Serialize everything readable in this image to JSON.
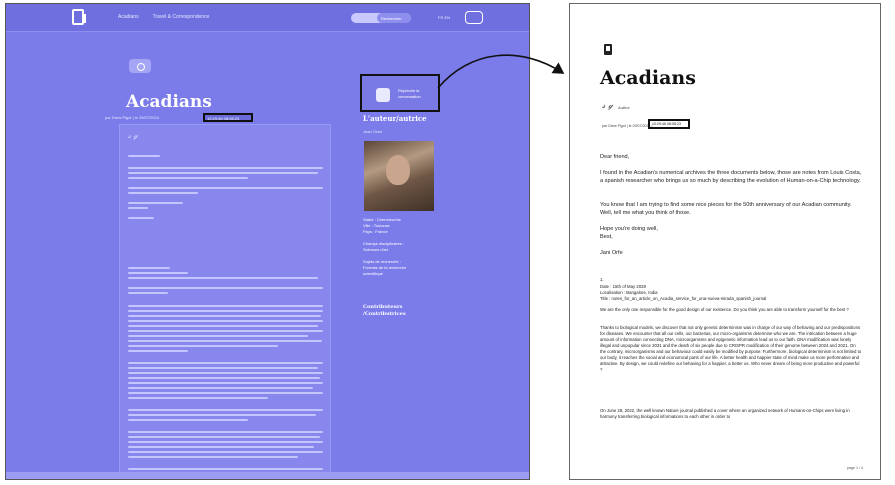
{
  "app": {
    "nav": [
      "Acadians",
      "Travel & Correspondence"
    ],
    "search_label": "Rechercher",
    "lang": "FR EN",
    "title": "Acadians",
    "meta": "par Drew Pigot | le 29/07/2024",
    "date_highlight": "10:29:46 08:08:23",
    "side_box_text_1": "Rejoindre la",
    "side_box_text_2": "conversation",
    "side_heading": "L'auteur/autrice",
    "side_sub": "Jean Ochs",
    "side_info_1": "Statut : Chercheur/se",
    "side_info_2": "Ville : Toulouse",
    "side_info_3": "Pays : France",
    "side_info_4": "Champs disciplinaires :",
    "side_info_5": "Sciences d'art",
    "side_info_6": "Sujets de recherche :",
    "side_info_7": "Formats de la recherche",
    "side_info_8": "scientifique",
    "side_heading_2a": "Contributeurs",
    "side_heading_2b": "/Contributrices"
  },
  "doc": {
    "title": "Acadians",
    "signature_name": "Author",
    "meta": "par Drew Pigot | le 29/07/2024 |",
    "date_highlight": "10:29:46 08:08:23",
    "greeting": "Dear friend,",
    "para1": "I found in the Acadian's numerical archives the three documents below, those are notes from Louis Costa, a spanish researcher who brings us so much by describing the evolution of Human-on-a-Chip technology.",
    "para2": "You know that I am trying to find some nice pieces for the 50th anniversary of our Acadian community. Well, tell me what you think of those.",
    "para3a": "Hope you're doing well,",
    "para3b": "Best,",
    "signoff": "Jani Orfe",
    "section_no": "1.",
    "date_line": "Date : 15th of May 2028",
    "loc_line": "Localisation : Bangalore, India",
    "title_line": "Title : notes_for_an_article_on_Acadia_service_for_una-nueva-mirada_spanish_journal",
    "para4": "We are the only one responsible for the good design of our existence. Do you think you are able to transform yourself for the best ?",
    "para5": "Thanks to biological models, we discover that not only genetic determinism was in charge of our way of behaving and our predispositions for diseases. We encounter that all our cells, our bacterias, our micro-organisms determine who we are. The intrication between a huge amount of information connecting DNA, microorganisms and epigenetic information lead us to our faith. DNA modification was lonely illegal and unpopular since 2031 and the death of six people due to CRISPR modification of their genome between 2024 and 2021. On the contrary, microorganisms and our behaviour could easily be modified by purpose. Furthermore, biological determinism is not limited to our body, it reaches the social and economical parts of our life. A better health and happier state of mind make us more performative and attractive. By design, we could redefine our behaving for a happier, a better us. Who never dream of being more productive and powerful ?",
    "para6": "On June 28, 2022, the well known Nature journal published a cover where an organized network of Humans-on-Chips were living in harmony transferring biological informations to each other in order to",
    "page_no": "page 1 / 4"
  },
  "colors": {
    "app_bg": "#7b7bea",
    "highlight_border": "#111111"
  }
}
